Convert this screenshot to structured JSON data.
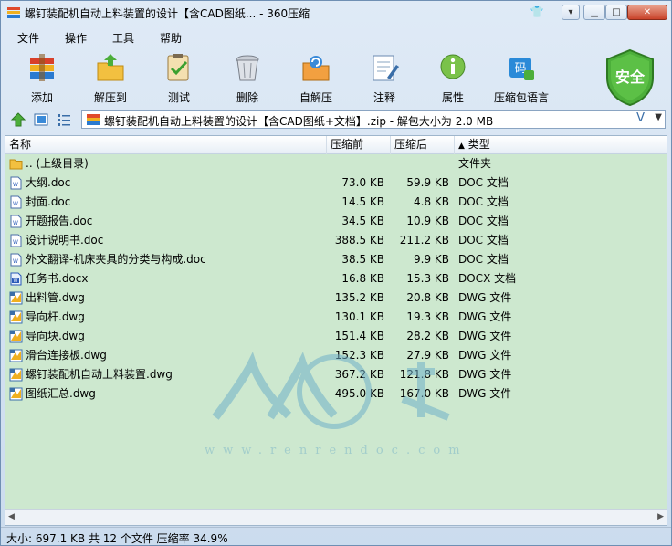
{
  "window": {
    "title": "螺钉装配机自动上料装置的设计【含CAD图纸... - 360压缩"
  },
  "menu": [
    "文件",
    "操作",
    "工具",
    "帮助"
  ],
  "toolbar": [
    {
      "label": "添加",
      "icon": "add-books-icon"
    },
    {
      "label": "解压到",
      "icon": "extract-folder-icon"
    },
    {
      "label": "测试",
      "icon": "test-clipboard-icon"
    },
    {
      "label": "删除",
      "icon": "trash-icon"
    },
    {
      "label": "自解压",
      "icon": "self-extract-icon"
    },
    {
      "label": "注释",
      "icon": "comment-icon"
    },
    {
      "label": "属性",
      "icon": "info-icon"
    },
    {
      "label": "压缩包语言",
      "icon": "language-icon"
    }
  ],
  "security": {
    "label": "安全"
  },
  "address": {
    "path": "螺钉装配机自动上料装置的设计【含CAD图纸+文档】.zip - 解包大小为 2.0 MB"
  },
  "columns": {
    "name": "名称",
    "size": "压缩前",
    "packed": "压缩后",
    "type": "类型",
    "sort_indicator": "▲"
  },
  "files": [
    {
      "name": ".. (上级目录)",
      "size": "",
      "packed": "",
      "type": "文件夹",
      "icon": "folder-icon"
    },
    {
      "name": "大纲.doc",
      "size": "73.0 KB",
      "packed": "59.9 KB",
      "type": "DOC 文档",
      "icon": "doc-icon"
    },
    {
      "name": "封面.doc",
      "size": "14.5 KB",
      "packed": "4.8 KB",
      "type": "DOC 文档",
      "icon": "doc-icon"
    },
    {
      "name": "开题报告.doc",
      "size": "34.5 KB",
      "packed": "10.9 KB",
      "type": "DOC 文档",
      "icon": "doc-icon"
    },
    {
      "name": "设计说明书.doc",
      "size": "388.5 KB",
      "packed": "211.2 KB",
      "type": "DOC 文档",
      "icon": "doc-icon"
    },
    {
      "name": "外文翻译-机床夹具的分类与构成.doc",
      "size": "38.5 KB",
      "packed": "9.9 KB",
      "type": "DOC 文档",
      "icon": "doc-icon"
    },
    {
      "name": "任务书.docx",
      "size": "16.8 KB",
      "packed": "15.3 KB",
      "type": "DOCX 文档",
      "icon": "docx-icon"
    },
    {
      "name": "出料管.dwg",
      "size": "135.2 KB",
      "packed": "20.8 KB",
      "type": "DWG 文件",
      "icon": "dwg-icon"
    },
    {
      "name": "导向杆.dwg",
      "size": "130.1 KB",
      "packed": "19.3 KB",
      "type": "DWG 文件",
      "icon": "dwg-icon"
    },
    {
      "name": "导向块.dwg",
      "size": "151.4 KB",
      "packed": "28.2 KB",
      "type": "DWG 文件",
      "icon": "dwg-icon"
    },
    {
      "name": "滑台连接板.dwg",
      "size": "152.3 KB",
      "packed": "27.9 KB",
      "type": "DWG 文件",
      "icon": "dwg-icon"
    },
    {
      "name": "螺钉装配机自动上料装置.dwg",
      "size": "367.2 KB",
      "packed": "121.8 KB",
      "type": "DWG 文件",
      "icon": "dwg-icon"
    },
    {
      "name": "图纸汇总.dwg",
      "size": "495.0 KB",
      "packed": "167.0 KB",
      "type": "DWG 文件",
      "icon": "dwg-icon"
    }
  ],
  "status": {
    "text": "大小: 697.1 KB 共 12 个文件 压缩率 34.9%"
  },
  "watermark": {
    "text": "www.renrendoc.com"
  },
  "colors": {
    "list_bg": "#cde8cf",
    "accent": "#3a6ea8",
    "shield": "#4caf3a"
  }
}
